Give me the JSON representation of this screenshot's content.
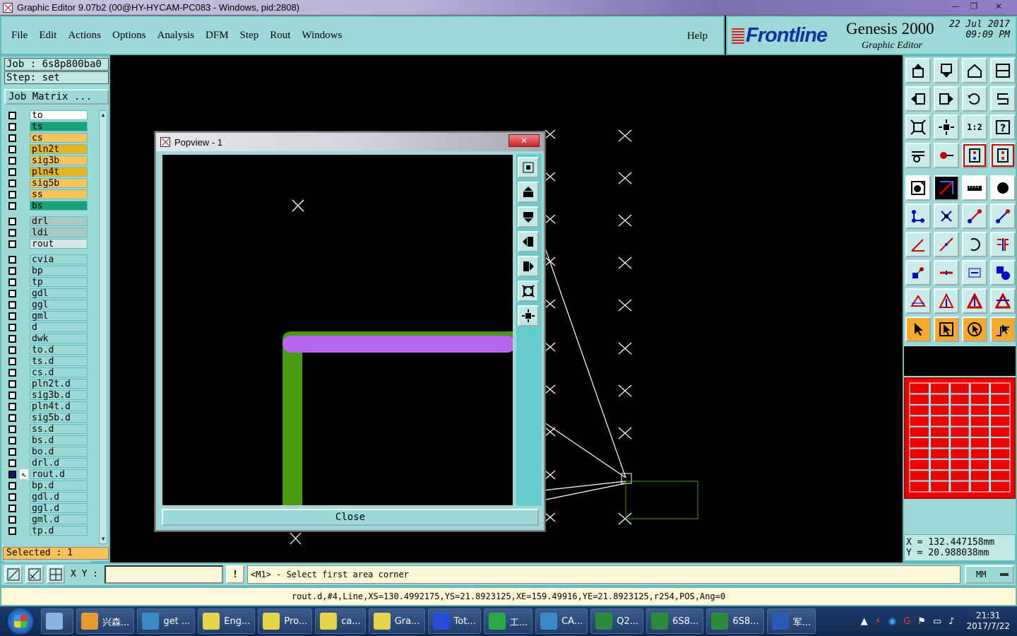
{
  "window": {
    "title": "Graphic Editor 9.07b2 (00@HY-HYCAM-PC083 - Windows, pid:2808)",
    "min": "—",
    "max": "❐",
    "close": "✕"
  },
  "menu": {
    "items": [
      "File",
      "Edit",
      "Actions",
      "Options",
      "Analysis",
      "DFM",
      "Step",
      "Rout",
      "Windows"
    ],
    "help": "Help"
  },
  "brand": {
    "logo": "Frontline",
    "product": "Genesis 2000",
    "subtitle": "Graphic Editor",
    "date": "22 Jul 2017",
    "time": "09:09 PM"
  },
  "job": {
    "job_label": "Job : 6s8p800ba0",
    "step_label": "Step: set",
    "matrix_button": "Job Matrix ..."
  },
  "layers": [
    {
      "name": "to",
      "color": "#ffffff"
    },
    {
      "name": "ts",
      "color": "#1aa37a"
    },
    {
      "name": "cs",
      "color": "#f6c35a"
    },
    {
      "name": "pln2t",
      "color": "#e6b422"
    },
    {
      "name": "sig3b",
      "color": "#f6c35a"
    },
    {
      "name": "pln4t",
      "color": "#e6b422"
    },
    {
      "name": "sig5b",
      "color": "#f6c35a"
    },
    {
      "name": "ss",
      "color": "#f6c35a"
    },
    {
      "name": "bs",
      "color": "#1aa37a"
    },
    {
      "name": "drl",
      "color": "#a8c8c8"
    },
    {
      "name": "ldi",
      "color": "#a8c8c8"
    },
    {
      "name": "rout",
      "color": "#d8e8e8"
    },
    {
      "name": "cvia",
      "color": "#9dd9d6"
    },
    {
      "name": "bp",
      "color": "#9dd9d6"
    },
    {
      "name": "tp",
      "color": "#9dd9d6"
    },
    {
      "name": "gdl",
      "color": "#9dd9d6"
    },
    {
      "name": "ggl",
      "color": "#9dd9d6"
    },
    {
      "name": "gml",
      "color": "#9dd9d6"
    },
    {
      "name": "d",
      "color": "#9dd9d6"
    },
    {
      "name": "dwk",
      "color": "#9dd9d6"
    },
    {
      "name": "to.d",
      "color": "#9dd9d6"
    },
    {
      "name": "ts.d",
      "color": "#9dd9d6"
    },
    {
      "name": "cs.d",
      "color": "#9dd9d6"
    },
    {
      "name": "pln2t.d",
      "color": "#9dd9d6"
    },
    {
      "name": "sig3b.d",
      "color": "#9dd9d6"
    },
    {
      "name": "pln4t.d",
      "color": "#9dd9d6"
    },
    {
      "name": "sig5b.d",
      "color": "#9dd9d6"
    },
    {
      "name": "ss.d",
      "color": "#9dd9d6"
    },
    {
      "name": "bs.d",
      "color": "#9dd9d6"
    },
    {
      "name": "bo.d",
      "color": "#9dd9d6"
    },
    {
      "name": "drl.d",
      "color": "#9dd9d6"
    },
    {
      "name": "rout.d",
      "color": "#9dd9d6"
    },
    {
      "name": "bp.d",
      "color": "#9dd9d6"
    },
    {
      "name": "gdl.d",
      "color": "#9dd9d6"
    },
    {
      "name": "ggl.d",
      "color": "#9dd9d6"
    },
    {
      "name": "gml.d",
      "color": "#9dd9d6"
    },
    {
      "name": "tp.d",
      "color": "#9dd9d6"
    }
  ],
  "selected_label": "Selected : 1",
  "popview": {
    "title": "Popview - 1",
    "close_x": "✕",
    "close_button": "Close",
    "trace_colors": {
      "horizontal": "#b866f0",
      "vertical": "#4a9a10"
    }
  },
  "coords": {
    "x": "X = 132.447158mm",
    "y": "Y = 20.988038mm"
  },
  "command": {
    "xy_label": "X Y :",
    "xy_value": "",
    "warn": "!",
    "prompt": "<M1> - Select first area corner",
    "unit": "MM"
  },
  "status": "rout.d,#4,Line,XS=130.4992175,YS=21.8923125,XE=159.49916,YE=21.8923125,r254,POS,Ang=0",
  "taskbar": {
    "items": [
      {
        "label": "兴森...",
        "color": "#e89a2a"
      },
      {
        "label": "get ...",
        "color": "#3a8ac8"
      },
      {
        "label": "Eng...",
        "color": "#e8d44a"
      },
      {
        "label": "Pro...",
        "color": "#e8d44a"
      },
      {
        "label": "ca...",
        "color": "#e8d44a"
      },
      {
        "label": "Gra...",
        "color": "#e8d44a"
      },
      {
        "label": "Tot...",
        "color": "#2a4ad8"
      },
      {
        "label": "工...",
        "color": "#2aa84a"
      },
      {
        "label": "CA...",
        "color": "#3a8ac8"
      },
      {
        "label": "Q2...",
        "color": "#2a8a3a"
      },
      {
        "label": "6S8...",
        "color": "#2a8a3a"
      },
      {
        "label": "6S8...",
        "color": "#2a8a3a"
      },
      {
        "label": "军...",
        "color": "#2a5ab8"
      }
    ],
    "clock_time": "21:31",
    "clock_date": "2017/7/22"
  }
}
